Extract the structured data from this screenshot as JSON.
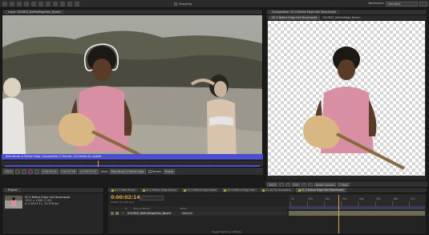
{
  "topbar": {
    "snapping_label": "Snapping",
    "workspace_label": "Workspace:",
    "workspace_value": "Standard"
  },
  "layer_panel": {
    "tab_label": "Layer: SOURCE_RefineEdgeHair_Beach",
    "status_text": "Roto Brush & Refine Edge: propagation 0 frames, 10 frames to update",
    "view_label": "View:",
    "view_value": "Roto Brush & Refine Edge",
    "render_label": "Render",
    "freeze_label": "Freeze",
    "zoom": "100%",
    "timecode_in": "0:00:00:00",
    "timecode_out": "0:00:07:06",
    "duration": "Δ 0:00:07:07"
  },
  "comp_panel": {
    "tab_label": "Composition: 02-5 Refine Edge Hair Beachwalk",
    "subtab_a": "02-5 Refine Edge Hair Beachwalk",
    "subtab_b": "SOURCE_RefineEdge_Beach",
    "zoom": "100%",
    "resolution": "Full",
    "camera": "Active Camera",
    "views": "1 View"
  },
  "project_panel": {
    "tab_label": "Project",
    "item_title": "02-5 Refine Edge Hair Beachwalk",
    "item_size": "1920 × 1080 (1.00)",
    "item_duration": "Δ 0:00:07:11, 23.976 fps"
  },
  "timeline": {
    "tabs": [
      {
        "label": "02-1 Roto Brush",
        "color": "#b0a030"
      },
      {
        "label": "02-2 Refine Edge Basics",
        "color": "#b0a030"
      },
      {
        "label": "02-3 Refine Edge Mode",
        "color": "#b0a030"
      },
      {
        "label": "02-4 Refine Edge Hair",
        "color": "#b0a030"
      },
      {
        "label": "02-4b Fix Shoulders",
        "color": "#b0a030"
      },
      {
        "label": "02-5 Refine Edge Hair Beachwalk",
        "color": "#b0a030"
      }
    ],
    "active_tab": 5,
    "timecode": "0:00:02:14",
    "fps": "00062 (23.976 fps)",
    "search_placeholder": "⌕",
    "header_num": "#",
    "header_source": "Source Name",
    "header_mode": "Mode",
    "layer_num": "1",
    "layer_name": "SOURCE_RefineEdgeHair_Beach",
    "layer_mode": "Normal",
    "bottom_toggle": "Toggle Switches / Modes",
    "ruler_ticks": [
      "0s",
      "01s",
      "02s",
      "03s",
      "04s",
      "05s",
      "06s",
      "07s"
    ]
  }
}
